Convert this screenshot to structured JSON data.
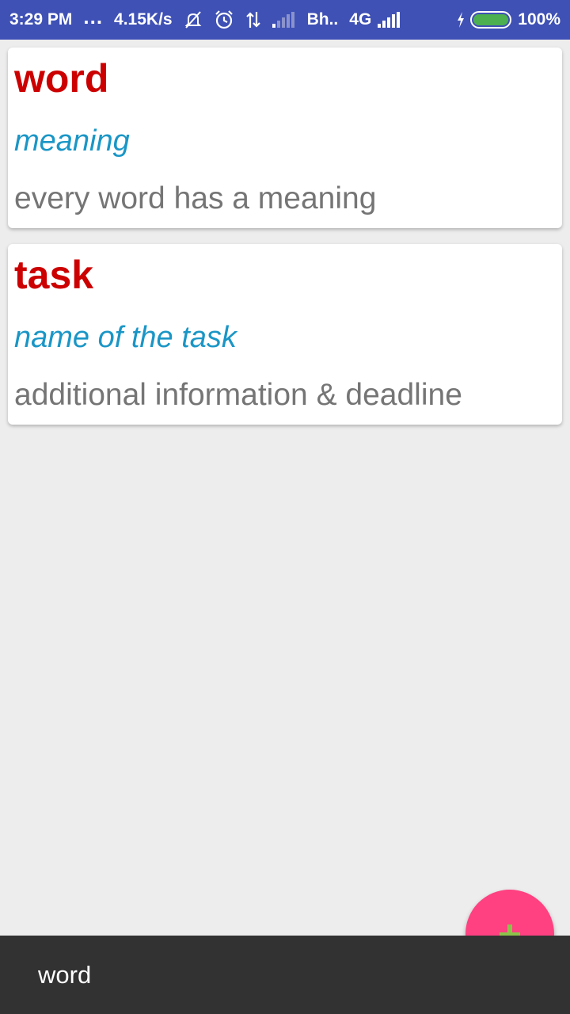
{
  "status_bar": {
    "time": "3:29 PM",
    "dots": "...",
    "speed": "4.15K/s",
    "carrier": "Bh..",
    "network": "4G",
    "battery_percent": "100%",
    "battery_level": 1.0,
    "icons": [
      "notifications-off-icon",
      "alarm-icon",
      "data-transfer-icon",
      "signal-icon",
      "signal-icon",
      "charging-icon",
      "battery-icon"
    ]
  },
  "cards": [
    {
      "title": "word",
      "subtitle": "meaning",
      "description": "every word has a meaning"
    },
    {
      "title": "task",
      "subtitle": "name of the task",
      "description": "additional information & deadline"
    }
  ],
  "fab": {
    "icon": "plus-icon",
    "color": "#ff4081",
    "icon_color": "#8bc34a"
  },
  "snackbar": {
    "text": "word"
  },
  "colors": {
    "status_bar": "#3f51b5",
    "title": "#cc0000",
    "subtitle": "#1a96c6",
    "description": "#757575",
    "background": "#ededed",
    "snackbar": "#323232"
  }
}
